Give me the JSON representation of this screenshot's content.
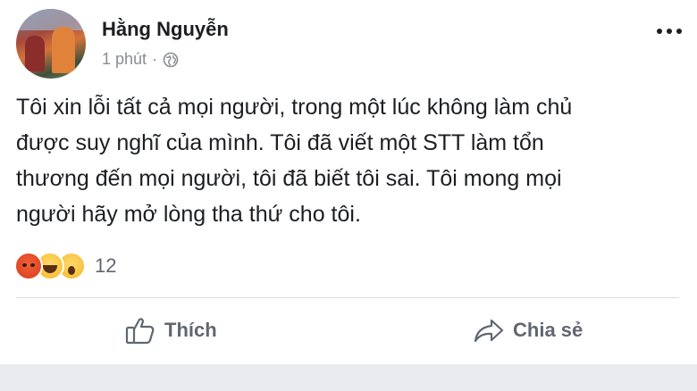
{
  "post": {
    "author_name": "Hằng Nguyễn",
    "timestamp": "1 phút",
    "separator": "·",
    "privacy_icon": "globe-icon",
    "more_icon": "more-options-icon",
    "text": "Tôi xin lỗi tất cả mọi người, trong một lúc không làm chủ\nđược suy nghĩ của mình. Tôi đã viết một STT làm tổn\nthương đến mọi người, tôi đã biết tôi sai. Tôi mong mọi\nngười hãy mở lòng tha thứ cho tôi."
  },
  "reactions": {
    "icons": [
      "angry-reaction-icon",
      "haha-reaction-icon",
      "wow-reaction-icon"
    ],
    "count": "12"
  },
  "actions": {
    "like_label": "Thích",
    "share_label": "Chia sẻ"
  },
  "colors": {
    "text": "#1c1e21",
    "secondary": "#606770",
    "meta": "#8a8d91",
    "divider": "#dadde1"
  }
}
